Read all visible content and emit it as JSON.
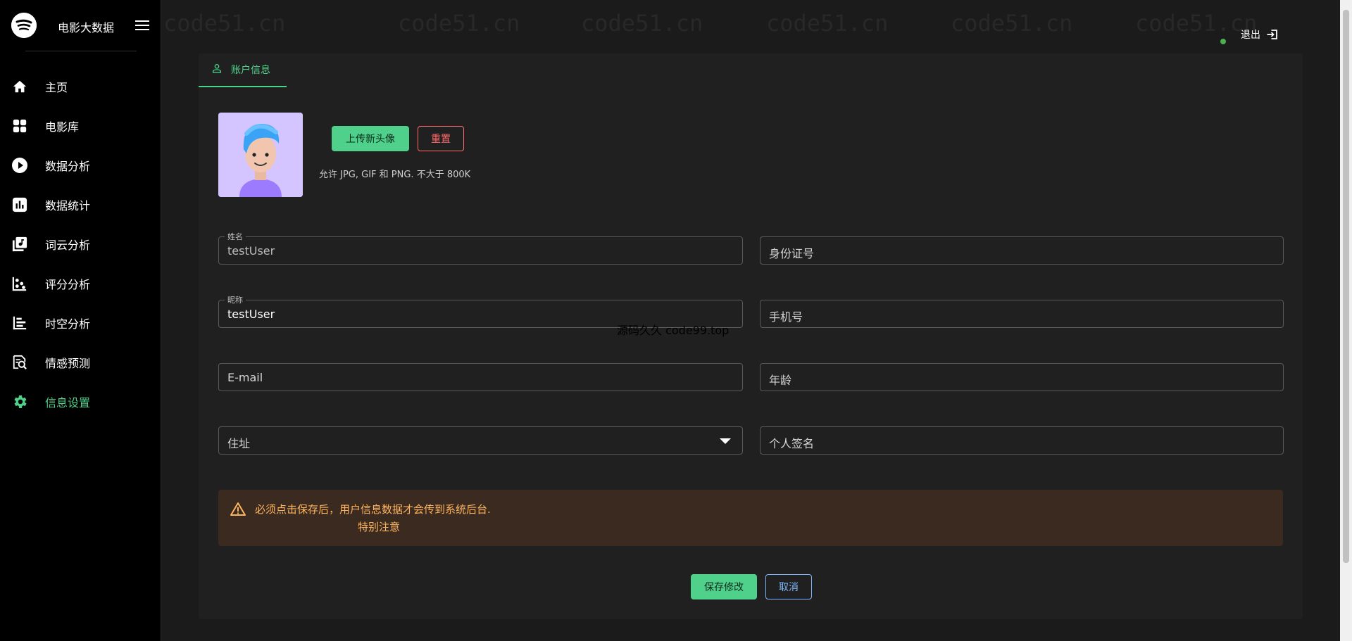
{
  "brand": {
    "title": "电影大数据"
  },
  "sidebar": {
    "items": [
      {
        "label": "主页",
        "icon": "home-icon"
      },
      {
        "label": "电影库",
        "icon": "grid-icon"
      },
      {
        "label": "数据分析",
        "icon": "play-circle-icon"
      },
      {
        "label": "数据统计",
        "icon": "bar-chart-icon"
      },
      {
        "label": "词云分析",
        "icon": "music-library-icon"
      },
      {
        "label": "评分分析",
        "icon": "scatter-chart-icon"
      },
      {
        "label": "时空分析",
        "icon": "timeline-icon"
      },
      {
        "label": "情感预测",
        "icon": "search-document-icon"
      },
      {
        "label": "信息设置",
        "icon": "gear-icon",
        "active": true
      }
    ]
  },
  "topbar": {
    "logout_label": "退出"
  },
  "tabs": [
    {
      "label": "账户信息",
      "icon": "user-icon"
    }
  ],
  "avatar": {
    "upload_label": "上传新头像",
    "reset_label": "重置",
    "hint": "允许 JPG, GIF 和 PNG. 不大于 800K"
  },
  "form": {
    "name": {
      "legend": "姓名",
      "value": "testUser"
    },
    "id_number": {
      "placeholder": "身份证号"
    },
    "nickname": {
      "legend": "昵称",
      "value": "testUser"
    },
    "phone": {
      "placeholder": "手机号"
    },
    "email": {
      "placeholder": "E-mail"
    },
    "age": {
      "placeholder": "年龄"
    },
    "address": {
      "placeholder": "住址"
    },
    "signature": {
      "placeholder": "个人签名"
    }
  },
  "watermark": {
    "main": "code51.cn",
    "center": "源码久久 code99.top"
  },
  "alert": {
    "line1": "必须点击保存后，用户信息数据才会传到系统后台.",
    "line2": "特别注意"
  },
  "actions": {
    "save_label": "保存修改",
    "cancel_label": "取消"
  },
  "colors": {
    "accent": "#4fd18b",
    "danger": "#ff6b6b",
    "info": "#7cb6ff",
    "warning": "#ffb460"
  }
}
